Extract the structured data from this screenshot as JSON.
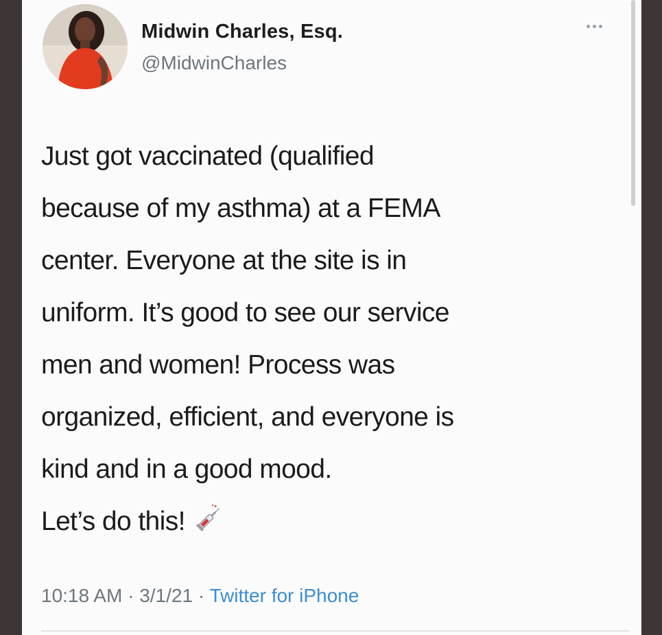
{
  "tweet": {
    "author": {
      "display_name": "Midwin Charles, Esq.",
      "handle": "@MidwinCharles",
      "avatar_icon": "profile-photo"
    },
    "more_icon": "ellipsis-icon",
    "body_lines": [
      "Just got vaccinated (qualified",
      "because of my asthma) at a FEMA",
      "center. Everyone at the site is in",
      "uniform. It’s good to see our service",
      "men and women! Process was",
      "organized, efficient, and everyone is",
      "kind and in a good mood.",
      "Let’s do this!"
    ],
    "emoji_icon": "syringe-icon",
    "time": "10:18 AM",
    "sep1": " · ",
    "date": "3/1/21",
    "sep2": " · ",
    "source": "Twitter for iPhone"
  },
  "colors": {
    "frame": "#3d3535",
    "card_bg": "#fbfbfb",
    "text": "#1b1b1b",
    "muted": "#6e767d",
    "link": "#3a8dd6"
  }
}
